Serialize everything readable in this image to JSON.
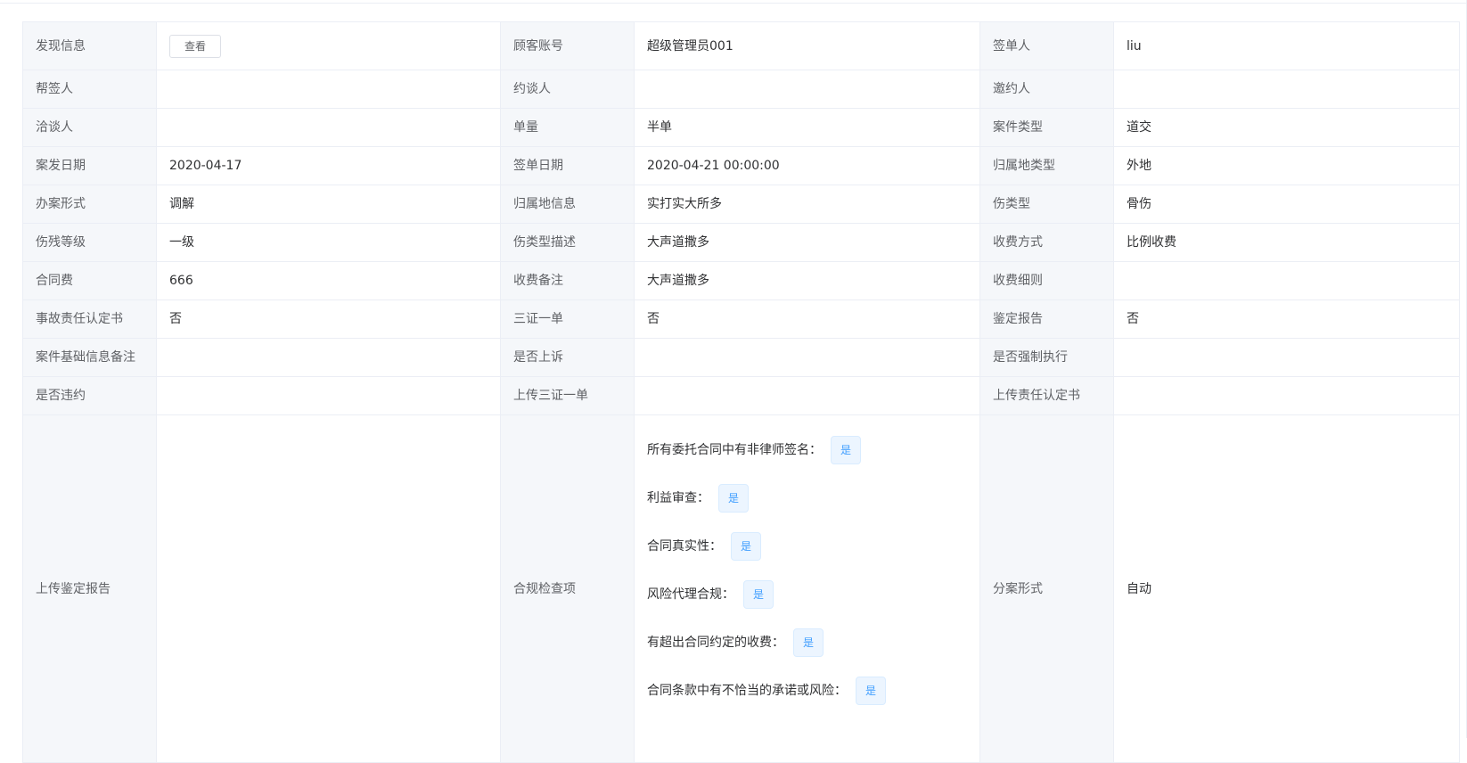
{
  "rows": [
    [
      {
        "label": "发现信息",
        "value": "",
        "button": "查看"
      },
      {
        "label": "顾客账号",
        "value": "超级管理员001"
      },
      {
        "label": "签单人",
        "value": "liu"
      }
    ],
    [
      {
        "label": "帮签人",
        "value": ""
      },
      {
        "label": "约谈人",
        "value": ""
      },
      {
        "label": "邀约人",
        "value": ""
      }
    ],
    [
      {
        "label": "洽谈人",
        "value": ""
      },
      {
        "label": "单量",
        "value": "半单"
      },
      {
        "label": "案件类型",
        "value": "道交"
      }
    ],
    [
      {
        "label": "案发日期",
        "value": "2020-04-17"
      },
      {
        "label": "签单日期",
        "value": "2020-04-21 00:00:00"
      },
      {
        "label": "归属地类型",
        "value": "外地"
      }
    ],
    [
      {
        "label": "办案形式",
        "value": "调解"
      },
      {
        "label": "归属地信息",
        "value": "实打实大所多"
      },
      {
        "label": "伤类型",
        "value": "骨伤"
      }
    ],
    [
      {
        "label": "伤残等级",
        "value": "一级"
      },
      {
        "label": "伤类型描述",
        "value": "大声道撒多"
      },
      {
        "label": "收费方式",
        "value": "比例收费"
      }
    ],
    [
      {
        "label": "合同费",
        "value": "666"
      },
      {
        "label": "收费备注",
        "value": "大声道撒多"
      },
      {
        "label": "收费细则",
        "value": ""
      }
    ],
    [
      {
        "label": "事故责任认定书",
        "value": "否"
      },
      {
        "label": "三证一单",
        "value": "否"
      },
      {
        "label": "鉴定报告",
        "value": "否"
      }
    ],
    [
      {
        "label": "案件基础信息备注",
        "value": ""
      },
      {
        "label": "是否上诉",
        "value": ""
      },
      {
        "label": "是否强制执行",
        "value": ""
      }
    ],
    [
      {
        "label": "是否违约",
        "value": ""
      },
      {
        "label": "上传三证一单",
        "value": ""
      },
      {
        "label": "上传责任认定书",
        "value": ""
      }
    ]
  ],
  "last_row": {
    "upload_label": "上传鉴定报告",
    "upload_value": "",
    "compliance_label": "合规检查项",
    "compliance_items": [
      {
        "text": "所有委托合同中有非律师签名：",
        "tag": "是"
      },
      {
        "text": "利益审查：",
        "tag": "是"
      },
      {
        "text": "合同真实性：",
        "tag": "是"
      },
      {
        "text": "风险代理合规：",
        "tag": "是"
      },
      {
        "text": "有超出合同约定的收费：",
        "tag": "是"
      },
      {
        "text": "合同条款中有不恰当的承诺或风险：",
        "tag": "是"
      }
    ],
    "split_label": "分案形式",
    "split_value": "自动"
  },
  "colors": {
    "label_bg": "#f5f7fa",
    "border": "#ebeef5",
    "tag_text": "#409eff",
    "tag_bg": "#ecf5ff"
  }
}
